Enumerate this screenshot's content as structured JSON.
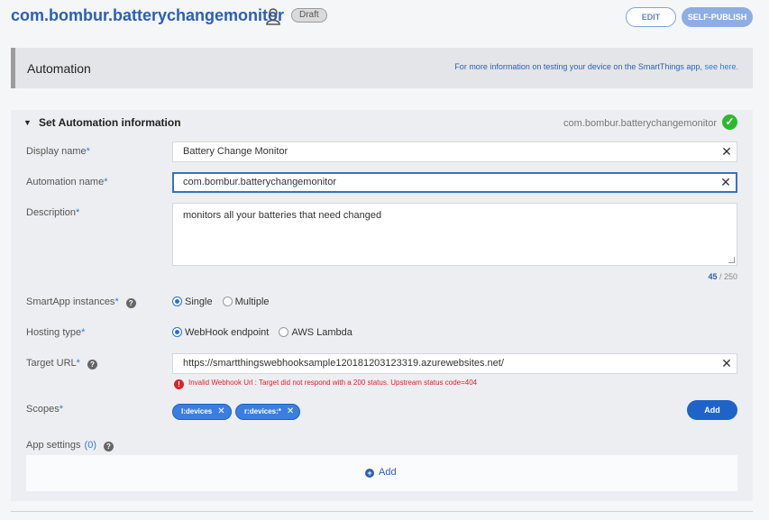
{
  "header": {
    "app_id": "com.bombur.batterychangemonitor",
    "status": "Draft",
    "edit_label": "EDIT",
    "publish_label": "SELF-PUBLISH"
  },
  "section": {
    "title": "Automation",
    "info_text": "For more information on testing your device on the SmartThings app,",
    "info_link": "see here."
  },
  "panel": {
    "title": "Set Automation information",
    "app_id": "com.bombur.batterychangemonitor",
    "valid": true
  },
  "form": {
    "display_name": {
      "label": "Display name",
      "required": "*",
      "value": "Battery Change Monitor"
    },
    "automation_name": {
      "label": "Automation name",
      "required": "*",
      "value": "com.bombur.batterychangemonitor"
    },
    "description": {
      "label": "Description",
      "required": "*",
      "value": "monitors all your batteries that need changed",
      "count": "45",
      "max": "/ 250"
    },
    "instances": {
      "label": "SmartApp instances",
      "required": "*",
      "options": [
        "Single",
        "Multiple"
      ],
      "selected": "Single"
    },
    "hosting": {
      "label": "Hosting type",
      "required": "*",
      "options": [
        "WebHook endpoint",
        "AWS Lambda"
      ],
      "selected": "WebHook endpoint"
    },
    "target_url": {
      "label": "Target URL",
      "required": "*",
      "value": "https://smartthingswebhooksample120181203123319.azurewebsites.net/",
      "error": "Invalid Webhook Url : Target did not respond with a 200 status. Upstream status code=404"
    },
    "scopes": {
      "label": "Scopes",
      "required": "*",
      "chips": [
        "l:devices",
        "r:devices:*"
      ],
      "add_label": "Add"
    },
    "app_settings": {
      "label": "App settings",
      "count": "(0)",
      "add_label": "Add"
    }
  },
  "colors": {
    "accent": "#2a5fb8",
    "error": "#d8232a",
    "success": "#2eb82e"
  }
}
